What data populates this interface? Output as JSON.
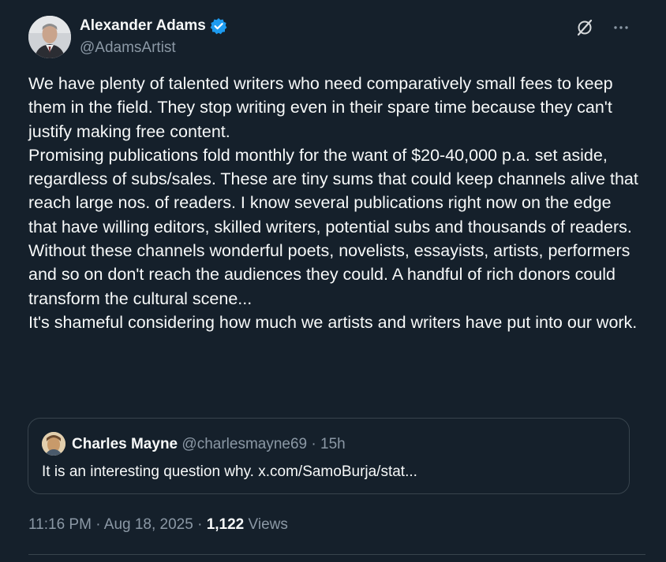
{
  "author": {
    "display_name": "Alexander Adams",
    "handle": "@AdamsArtist",
    "verified": true
  },
  "icons": {
    "grok": "grok-icon",
    "more": "more-icon"
  },
  "tweet": {
    "text": "We have plenty of talented writers who need comparatively small fees to keep them in the field. They stop writing even in their spare time because they can't justify making free content.\nPromising publications fold monthly for the want of $20-40,000 p.a. set aside, regardless of subs/sales. These are tiny sums that could keep channels alive that reach large nos. of readers. I know several publications right now on the edge that have willing editors, skilled writers, potential subs and thousands of readers.\nWithout these channels wonderful poets, novelists, essayists, artists, performers and so on don't reach the audiences they could. A handful of rich donors could transform the cultural scene...\nIt's shameful considering how much we artists and writers have put into our work."
  },
  "quote": {
    "display_name": "Charles Mayne",
    "handle": "@charlesmayne69",
    "separator": " · ",
    "time": "15h",
    "text": "It is an interesting question why. x.com/SamoBurja/stat..."
  },
  "meta": {
    "time": "11:16 PM",
    "separator": " · ",
    "date": "Aug 18, 2025",
    "views_count": "1,122",
    "views_label": "Views"
  },
  "colors": {
    "background": "#15202b",
    "primary_text": "#f7f9f9",
    "secondary_text": "#8b98a5",
    "border": "#38444d",
    "verified": "#1d9bf0"
  }
}
